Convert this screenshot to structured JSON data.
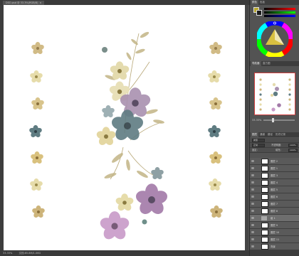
{
  "document": {
    "tab_title": "DSO.psd @ 33.3%(RGB/8)",
    "close": "×"
  },
  "status": {
    "zoom": "33.33%",
    "doc_info": "文档:85.8M/1.06G"
  },
  "panels": {
    "color": {
      "tabs": [
        "颜色",
        "色板"
      ],
      "foreground": "#b8a830",
      "background": "#1a1a1a"
    },
    "navigator": {
      "tabs": [
        "导航器",
        "直方图"
      ],
      "zoom": "33.33%"
    },
    "layers": {
      "tabs": [
        "图层",
        "通道",
        "路径",
        "历史记录"
      ],
      "filter_label": "类型",
      "blend_mode": "正常",
      "opacity_label": "不透明度:",
      "opacity": "100%",
      "lock_label": "锁定:",
      "fill_label": "填充:",
      "fill": "100%",
      "items": [
        {
          "name": "图层 2",
          "type": "layer",
          "selected": false
        },
        {
          "name": "图层 1",
          "type": "layer",
          "selected": false
        },
        {
          "name": "图层 3",
          "type": "layer",
          "selected": false
        },
        {
          "name": "图层 4",
          "type": "layer",
          "selected": false
        },
        {
          "name": "图层 5",
          "type": "layer",
          "selected": false
        },
        {
          "name": "图层 6",
          "type": "layer",
          "selected": false
        },
        {
          "name": "图层 7",
          "type": "layer",
          "selected": false
        },
        {
          "name": "图层 8",
          "type": "layer",
          "selected": false
        },
        {
          "name": "组 1",
          "type": "group",
          "selected": true
        },
        {
          "name": "图层 9",
          "type": "layer",
          "selected": false
        },
        {
          "name": "图层 10",
          "type": "layer",
          "selected": false
        },
        {
          "name": "图层 11",
          "type": "layer",
          "selected": false
        },
        {
          "name": "背景",
          "type": "layer",
          "selected": false
        }
      ]
    }
  },
  "colors": {
    "canvas": "#ffffff",
    "flower_cream": "#e6dcaa",
    "flower_tan": "#cdb47a",
    "flower_teal": "#5f7c82",
    "flower_purple": "#a27aa8",
    "flower_pink": "#c89ac8",
    "leaf_olive": "#c2b486"
  }
}
